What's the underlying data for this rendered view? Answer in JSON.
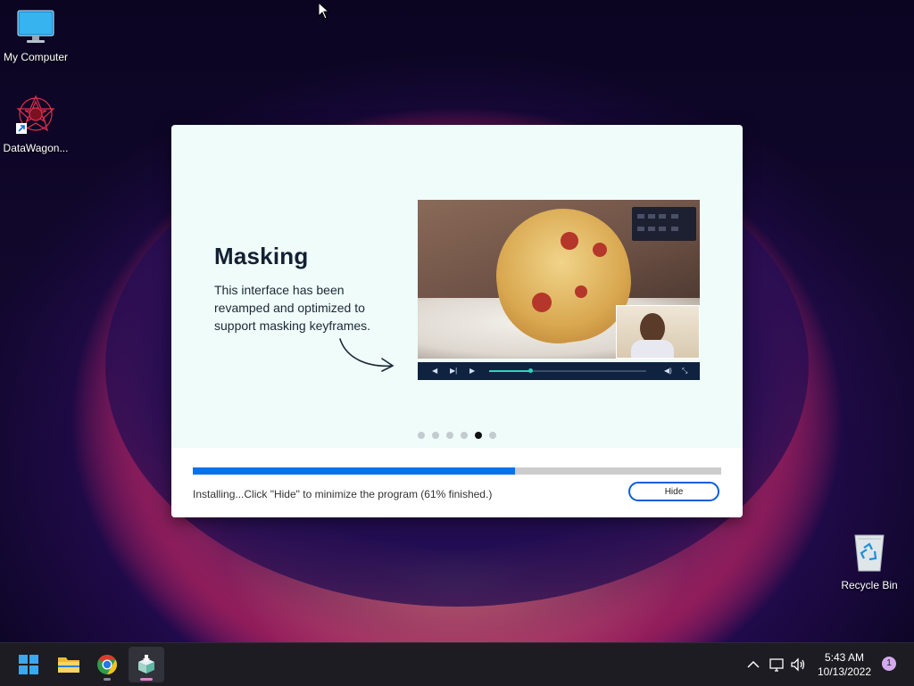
{
  "desktop": {
    "icons": [
      {
        "label": "My Computer",
        "icon": "monitor-icon"
      },
      {
        "label": "DataWagon...",
        "icon": "datawagon-app-icon"
      },
      {
        "label": "Recycle Bin",
        "icon": "recycle-bin-icon"
      }
    ]
  },
  "installer": {
    "slide": {
      "title": "Masking",
      "description": "This interface has been revamped and optimized to support masking keyframes.",
      "total_slides": 6,
      "active_slide": 5
    },
    "progress": {
      "percent": 61,
      "status_text": "Installing...Click \"Hide\" to minimize the program (61% finished.)"
    },
    "hide_label": "Hide",
    "colors": {
      "accent": "#0a72e8",
      "background": "#effcf9"
    }
  },
  "taskbar": {
    "apps": [
      {
        "name": "start",
        "icon": "windows-start-icon"
      },
      {
        "name": "file-explorer",
        "icon": "folder-icon"
      },
      {
        "name": "chrome",
        "icon": "chrome-icon"
      },
      {
        "name": "installer",
        "icon": "installer-icon",
        "active": true
      }
    ],
    "clock": {
      "time": "5:43 AM",
      "date": "10/13/2022"
    },
    "notification_count": "1"
  }
}
